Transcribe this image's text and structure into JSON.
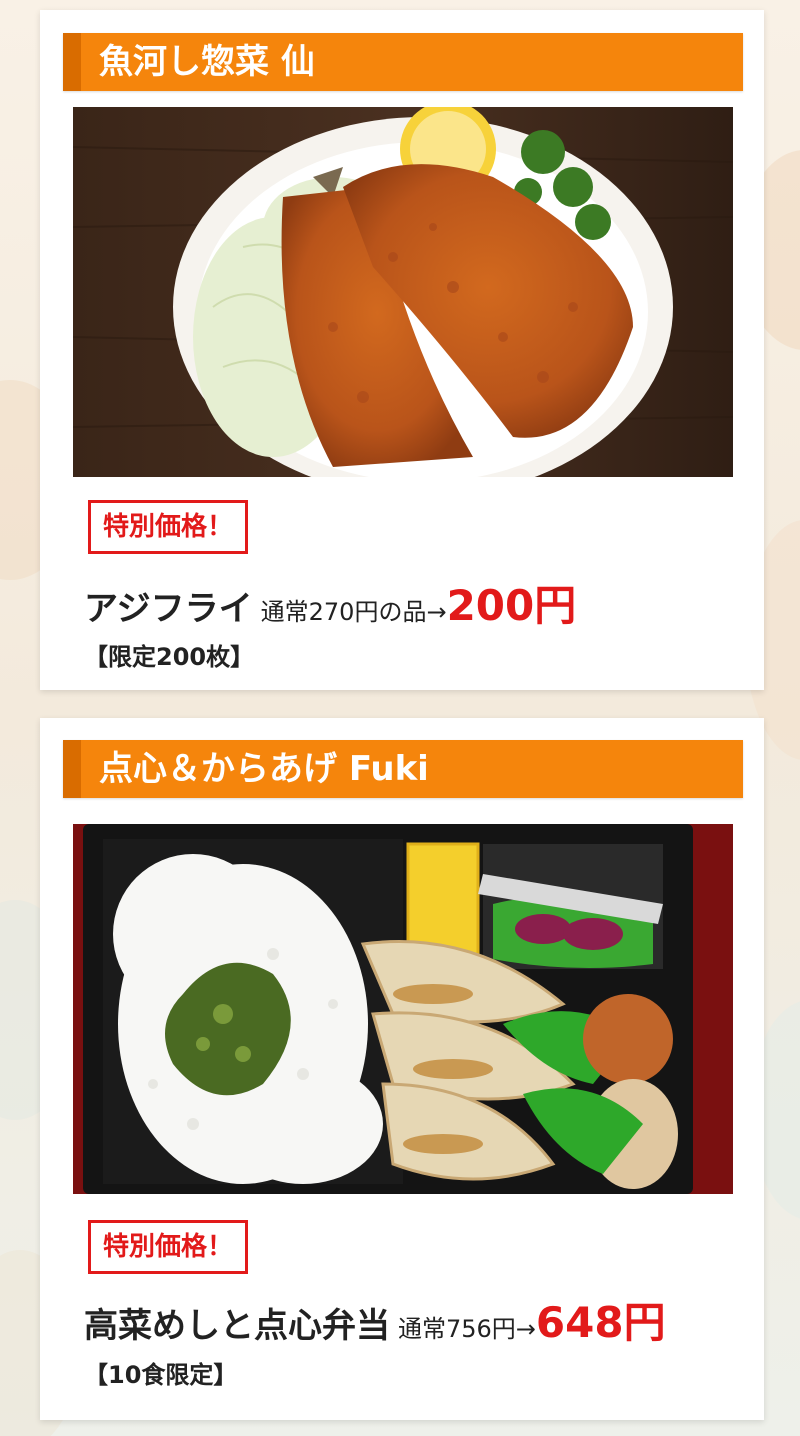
{
  "colors": {
    "accent_orange": "#f5850c",
    "accent_orange_dark": "#d96c00",
    "sale_red": "#e21a1a",
    "card_white": "#ffffff"
  },
  "shops": [
    {
      "name": "魚河し惣菜 仙",
      "photo": "fried-horse-mackerel-photo",
      "special_label": "特別価格！",
      "item": "アジフライ",
      "regular_price": "通常270円の品→",
      "sale_price": "200円",
      "limit": "【限定200枚】"
    },
    {
      "name": "点心＆からあげ Fuki",
      "photo": "bento-box-photo",
      "special_label": "特別価格！",
      "item": "高菜めしと点心弁当",
      "regular_price": "通常756円→",
      "sale_price": "648円",
      "limit": "【10食限定】"
    }
  ]
}
